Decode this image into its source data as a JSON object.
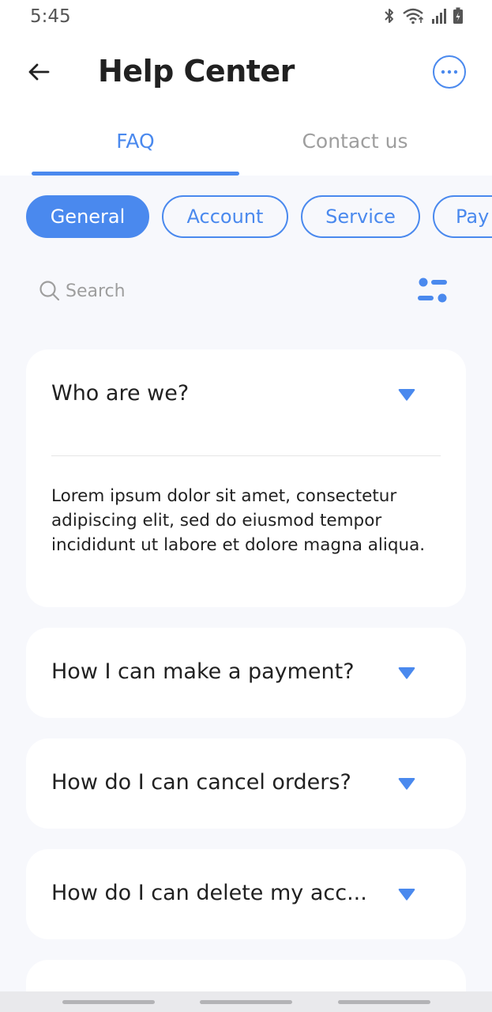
{
  "status_bar": {
    "time": "5:45"
  },
  "header": {
    "title": "Help Center"
  },
  "tabs": [
    {
      "label": "FAQ",
      "active": true
    },
    {
      "label": "Contact us",
      "active": false
    }
  ],
  "categories": [
    {
      "label": "General",
      "active": true
    },
    {
      "label": "Account",
      "active": false
    },
    {
      "label": "Service",
      "active": false
    },
    {
      "label": "Pay",
      "active": false
    }
  ],
  "search": {
    "placeholder": "Search",
    "value": ""
  },
  "faq": [
    {
      "question": "Who are we?",
      "expanded": true,
      "answer": "Lorem ipsum dolor sit amet, consectetur adipiscing elit, sed do eiusmod tempor incididunt ut labore et dolore magna aliqua."
    },
    {
      "question": "How I can make a payment?",
      "expanded": false
    },
    {
      "question": "How do I can cancel orders?",
      "expanded": false
    },
    {
      "question": "How do I can delete my acc...",
      "expanded": false
    }
  ],
  "colors": {
    "accent": "#4a89ee",
    "background": "#f7f8fc",
    "card": "#ffffff",
    "text": "#212121",
    "muted": "#9e9e9e"
  },
  "icons": [
    "bluetooth-icon",
    "wifi-icon",
    "signal-icon",
    "battery-icon",
    "back-arrow-icon",
    "more-icon",
    "search-icon",
    "filter-icon",
    "caret-down-icon"
  ]
}
